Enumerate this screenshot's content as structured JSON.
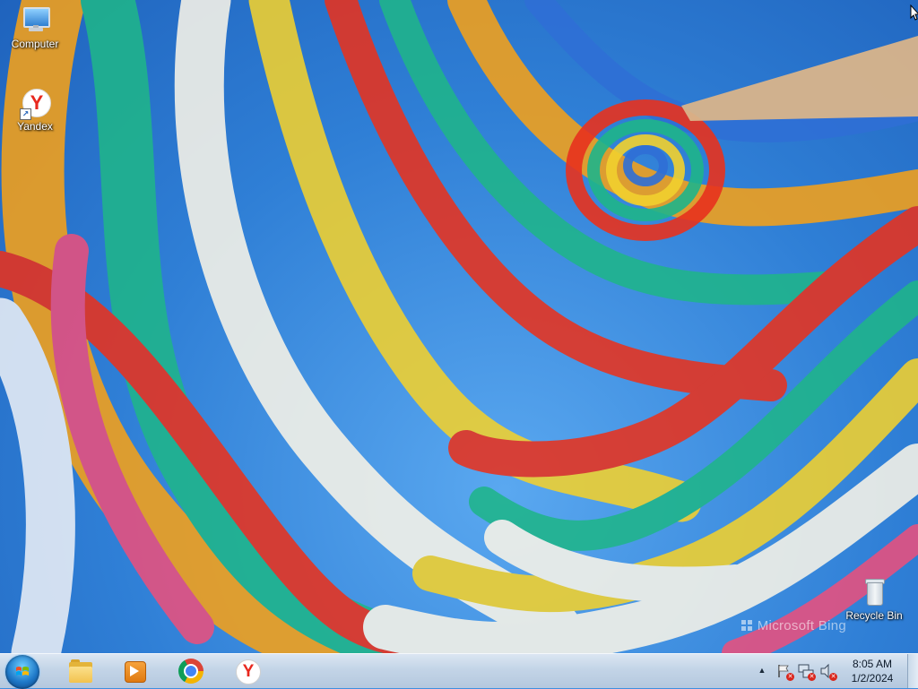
{
  "desktop": {
    "icons": [
      {
        "label": "Computer",
        "icon": "computer-icon"
      },
      {
        "label": "Yandex",
        "icon": "yandex-icon"
      },
      {
        "label": "Recycle Bin",
        "icon": "recycle-bin-icon"
      }
    ],
    "wallpaper": {
      "watermark": "Microsoft Bing",
      "colors": [
        "#e8321e",
        "#f4a11a",
        "#f2d12e",
        "#1fb58a",
        "#2f6fd6",
        "#ffffff",
        "#e9507e"
      ]
    }
  },
  "taskbar": {
    "start": {
      "icon": "windows-start-icon"
    },
    "pinned": [
      {
        "name": "Windows Explorer",
        "icon": "folder-icon"
      },
      {
        "name": "Windows Media Player",
        "icon": "media-player-icon"
      },
      {
        "name": "Google Chrome",
        "icon": "chrome-icon"
      },
      {
        "name": "Yandex Browser",
        "icon": "yandex-browser-icon"
      }
    ],
    "tray": {
      "overflow_icon": "chevron-up-icon",
      "icons": [
        "action-center-flag-icon",
        "network-icon",
        "volume-muted-icon"
      ]
    },
    "clock": {
      "time": "8:05 AM",
      "date": "1/2/2024"
    }
  },
  "theme": {
    "taskbar_color": "#c3d4e7",
    "desktop_sky": "#3f8fe0"
  }
}
